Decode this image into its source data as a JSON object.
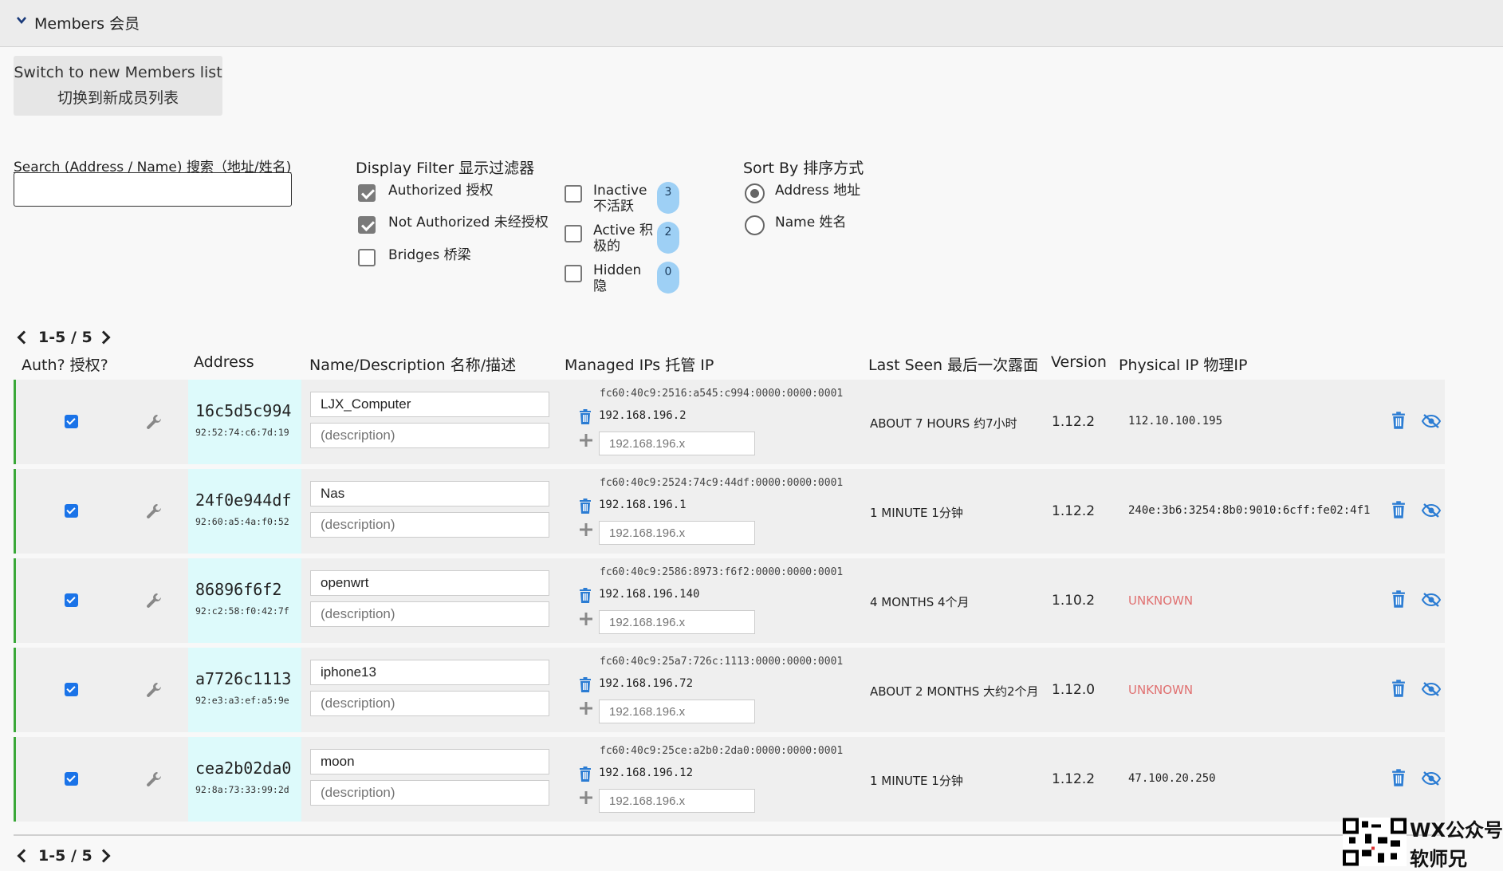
{
  "header": {
    "title": "Members 会员"
  },
  "switch_button": {
    "line1": "Switch to new Members list",
    "line2": "切换到新成员列表"
  },
  "search": {
    "label": "Search (Address / Name) 搜索（地址/姓名)",
    "value": "",
    "placeholder": ""
  },
  "display_filter": {
    "title": "Display Filter 显示过滤器",
    "options": [
      {
        "label": "Authorized 授权",
        "checked": true
      },
      {
        "label": "Not Authorized 未经授权",
        "checked": true
      },
      {
        "label": "Bridges 桥梁",
        "checked": false
      }
    ],
    "status_options": [
      {
        "label_line1": "Inactive",
        "label_line2": "不活跃",
        "count": "3",
        "checked": false
      },
      {
        "label_line1": "Active 积",
        "label_line2": "极的",
        "count": "2",
        "checked": false
      },
      {
        "label_line1": "Hidden",
        "label_line2": "隐",
        "count": "0",
        "checked": false
      }
    ]
  },
  "sort_by": {
    "title": "Sort By 排序方式",
    "options": [
      {
        "label": "Address 地址",
        "selected": true
      },
      {
        "label": "Name 姓名",
        "selected": false
      }
    ]
  },
  "pager": {
    "text": "1-5 / 5"
  },
  "columns": {
    "auth": "Auth? 授权?",
    "address": "Address",
    "name": "Name/Description 名称/描述",
    "managed_ips": "Managed IPs 托管 IP",
    "last_seen": "Last Seen 最后一次露面",
    "version": "Version",
    "physical_ip": "Physical IP 物理IP"
  },
  "members": [
    {
      "address": "16c5d5c994",
      "mac": "92:52:74:c6:7d:19",
      "name": "LJX_Computer",
      "description_placeholder": "(description)",
      "ipv6": "fc60:40c9:2516:a545:c994:0000:0000:0001",
      "ipv4": "192.168.196.2",
      "ip_placeholder": "192.168.196.x",
      "last_seen": "ABOUT 7 HOURS 约7小时",
      "version": "1.12.2",
      "physical_ip": "112.10.100.195",
      "physical_unknown": false
    },
    {
      "address": "24f0e944df",
      "mac": "92:60:a5:4a:f0:52",
      "name": "Nas",
      "description_placeholder": "(description)",
      "ipv6": "fc60:40c9:2524:74c9:44df:0000:0000:0001",
      "ipv4": "192.168.196.1",
      "ip_placeholder": "192.168.196.x",
      "last_seen": "1 MINUTE 1分钟",
      "version": "1.12.2",
      "physical_ip": "240e:3b6:3254:8b0:9010:6cff:fe02:4f1",
      "physical_unknown": false
    },
    {
      "address": "86896f6f2",
      "mac": "92:c2:58:f0:42:7f",
      "name": "openwrt",
      "description_placeholder": "(description)",
      "ipv6": "fc60:40c9:2586:8973:f6f2:0000:0000:0001",
      "ipv4": "192.168.196.140",
      "ip_placeholder": "192.168.196.x",
      "last_seen": "4 MONTHS 4个月",
      "version": "1.10.2",
      "physical_ip": "UNKNOWN",
      "physical_unknown": true
    },
    {
      "address": "a7726c1113",
      "mac": "92:e3:a3:ef:a5:9e",
      "name": "iphone13",
      "description_placeholder": "(description)",
      "ipv6": "fc60:40c9:25a7:726c:1113:0000:0000:0001",
      "ipv4": "192.168.196.72",
      "ip_placeholder": "192.168.196.x",
      "last_seen": "ABOUT 2 MONTHS 大约2个月",
      "version": "1.12.0",
      "physical_ip": "UNKNOWN",
      "physical_unknown": true
    },
    {
      "address": "cea2b02da0",
      "mac": "92:8a:73:33:99:2d",
      "name": "moon",
      "description_placeholder": "(description)",
      "ipv6": "fc60:40c9:25ce:a2b0:2da0:0000:0000:0001",
      "ipv4": "192.168.196.12",
      "ip_placeholder": "192.168.196.x",
      "last_seen": "1 MINUTE 1分钟",
      "version": "1.12.2",
      "physical_ip": "47.100.20.250",
      "physical_unknown": false
    }
  ],
  "watermark": {
    "line1": "WX公众号",
    "line2": "软师兄"
  },
  "colors": {
    "accent_green": "#3aa838",
    "badge_blue": "#9ed0f5",
    "checkbox_blue": "#1a73e8",
    "address_bg": "#ddfafb",
    "unknown_red": "#e07070",
    "icon_blue": "#2b7cd3"
  }
}
